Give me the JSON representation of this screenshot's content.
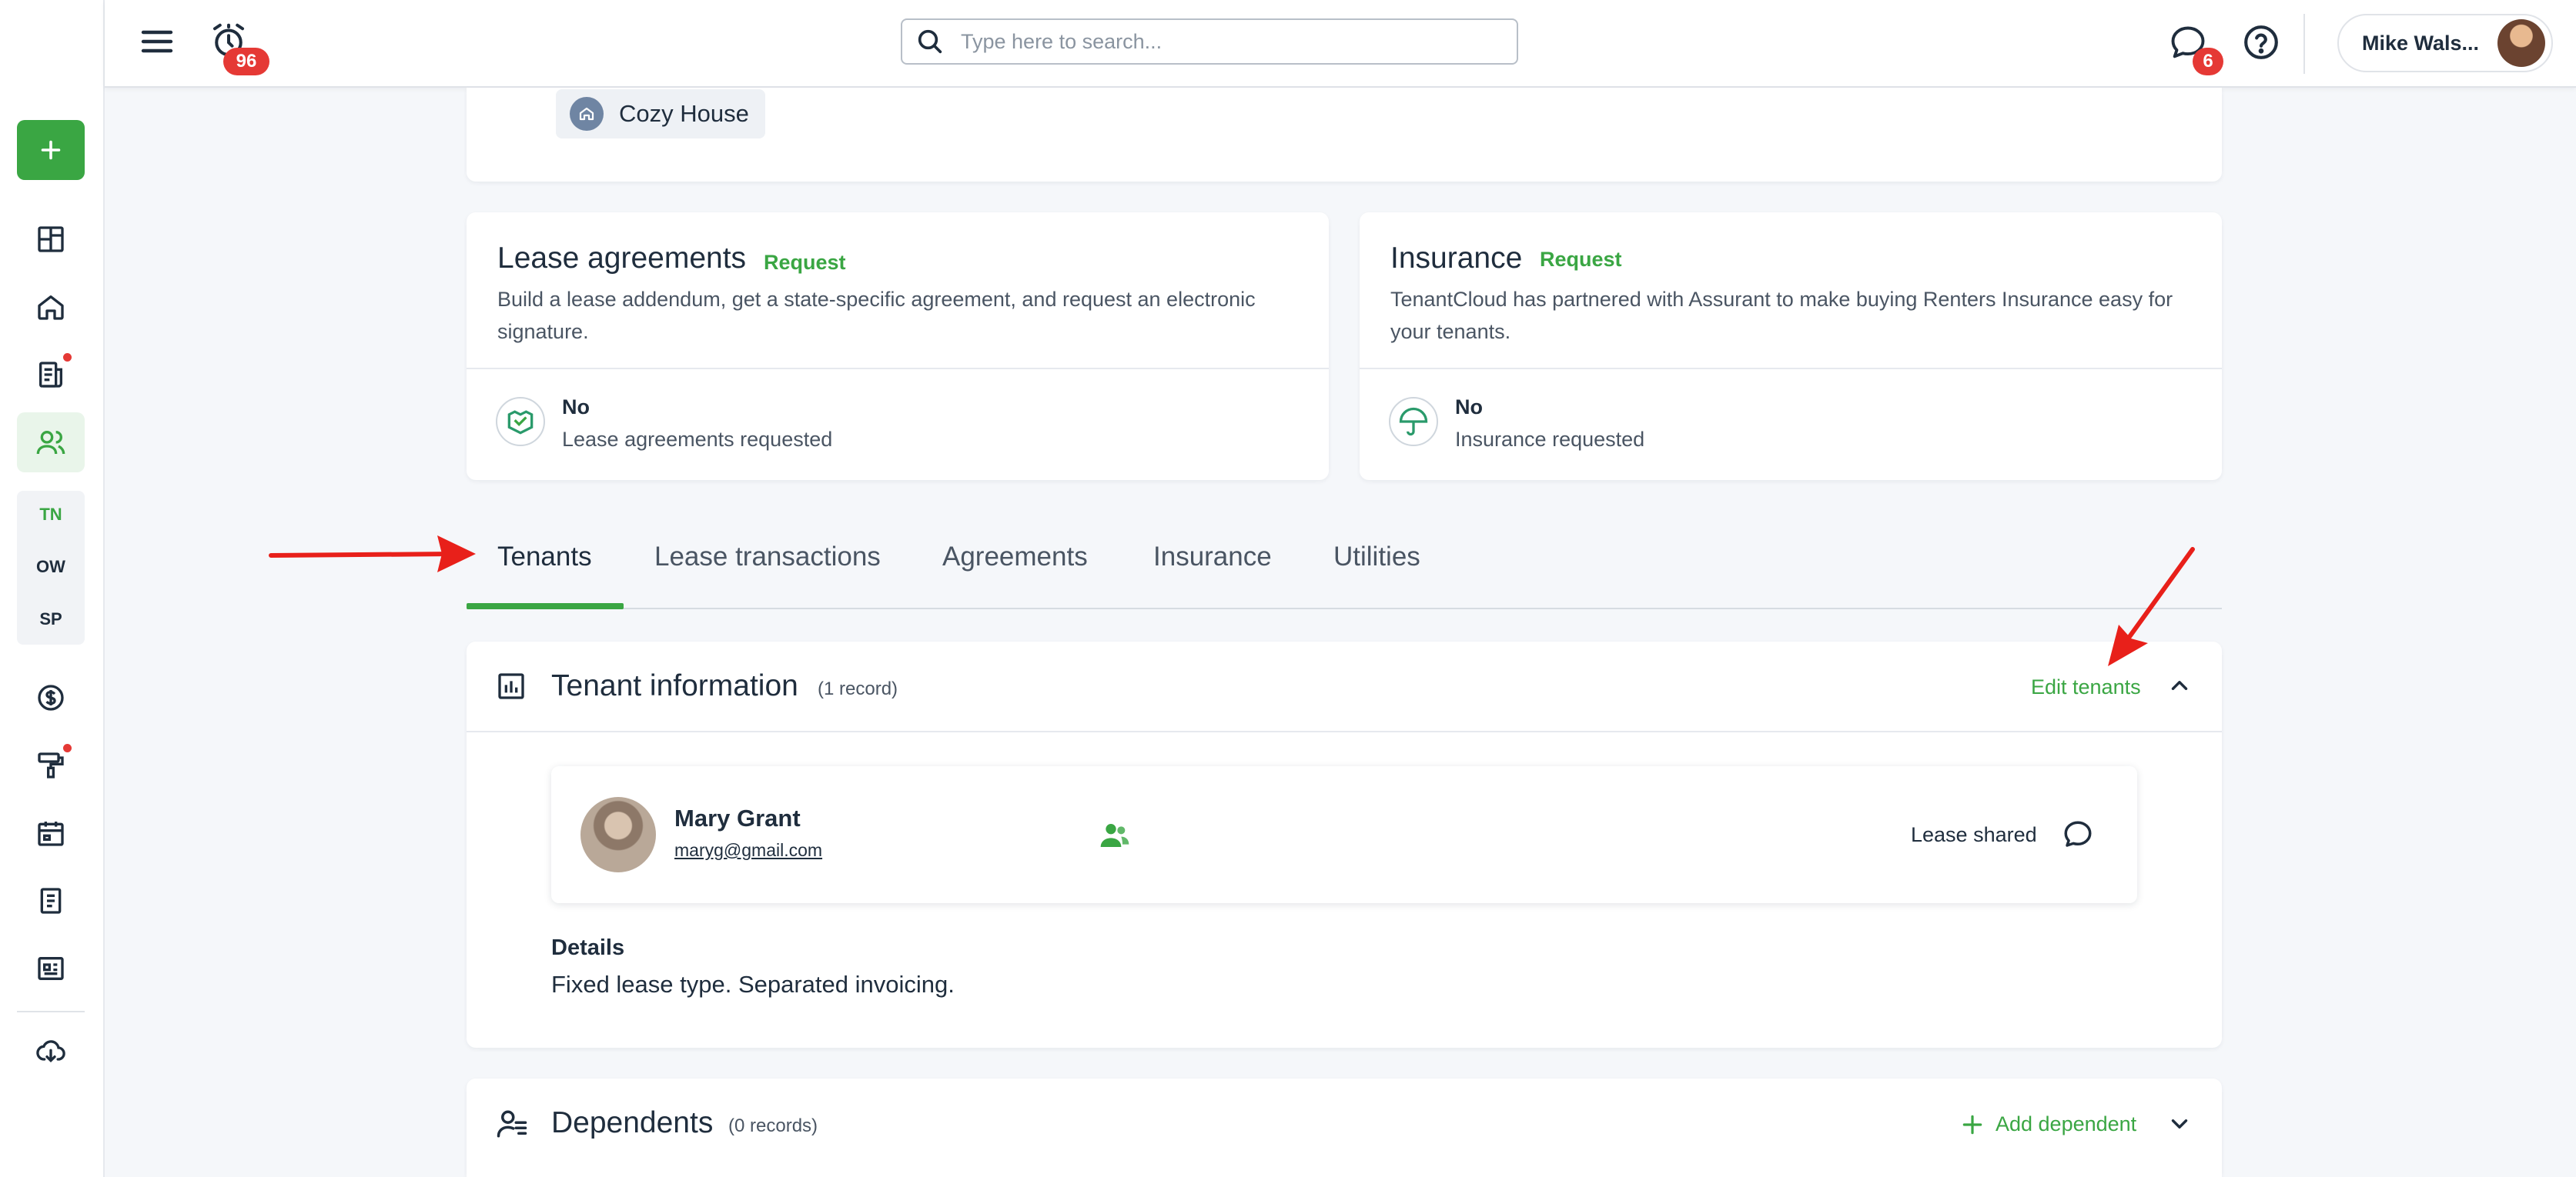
{
  "topbar": {
    "notifications_count": "96",
    "search_placeholder": "Type here to search...",
    "messages_count": "6",
    "user_name": "Mike Wals..."
  },
  "sidebar": {
    "codes": [
      "TN",
      "OW",
      "SP"
    ]
  },
  "property": {
    "name": "Cozy House"
  },
  "lease_card": {
    "title": "Lease agreements",
    "action": "Request",
    "description": "Build a lease addendum, get a state-specific agreement, and request an electronic signature.",
    "status": "No",
    "status_text": "Lease agreements requested"
  },
  "insurance_card": {
    "title": "Insurance",
    "action": "Request",
    "description": "TenantCloud has partnered with Assurant to make buying Renters Insurance easy for your tenants.",
    "status": "No",
    "status_text": "Insurance requested"
  },
  "tabs": [
    "Tenants",
    "Lease transactions",
    "Agreements",
    "Insurance",
    "Utilities"
  ],
  "tenant_info": {
    "title": "Tenant information",
    "count": "(1 record)",
    "edit_label": "Edit tenants",
    "tenant": {
      "name": "Mary Grant",
      "email": "maryg@gmail.com",
      "status": "Lease shared"
    },
    "details_label": "Details",
    "details_text": "Fixed lease type. Separated invoicing."
  },
  "dependents": {
    "title": "Dependents",
    "count": "(0 records)",
    "add_label": "Add dependent"
  },
  "colors": {
    "accent": "#3aa643",
    "badge": "#e53935",
    "arrow": "#e8201a"
  }
}
